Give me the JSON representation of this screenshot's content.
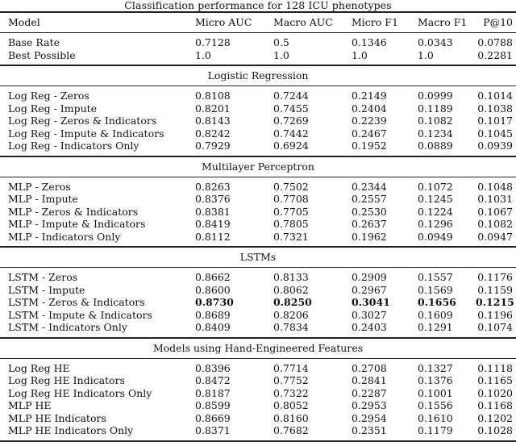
{
  "caption": "Classification performance for 128 ICU phenotypes",
  "columns": [
    "Model",
    "Micro AUC",
    "Macro AUC",
    "Micro F1",
    "Macro F1",
    "P@10"
  ],
  "baselines": [
    {
      "model": "Base Rate",
      "values": [
        "0.7128",
        "0.5",
        "0.1346",
        "0.0343",
        "0.0788"
      ]
    },
    {
      "model": "Best Possible",
      "values": [
        "1.0",
        "1.0",
        "1.0",
        "1.0",
        "0.2281"
      ]
    }
  ],
  "sections": [
    {
      "title": "Logistic Regression",
      "rows": [
        {
          "model": "Log Reg - Zeros",
          "values": [
            "0.8108",
            "0.7244",
            "0.2149",
            "0.0999",
            "0.1014"
          ]
        },
        {
          "model": "Log Reg - Impute",
          "values": [
            "0.8201",
            "0.7455",
            "0.2404",
            "0.1189",
            "0.1038"
          ]
        },
        {
          "model": "Log Reg - Zeros & Indicators",
          "values": [
            "0.8143",
            "0.7269",
            "0.2239",
            "0.1082",
            "0.1017"
          ]
        },
        {
          "model": "Log Reg - Impute & Indicators",
          "values": [
            "0.8242",
            "0.7442",
            "0.2467",
            "0.1234",
            "0.1045"
          ]
        },
        {
          "model": "Log Reg - Indicators Only",
          "values": [
            "0.7929",
            "0.6924",
            "0.1952",
            "0.0889",
            "0.0939"
          ]
        }
      ]
    },
    {
      "title": "Multilayer Perceptron",
      "rows": [
        {
          "model": "MLP - Zeros",
          "values": [
            "0.8263",
            "0.7502",
            "0.2344",
            "0.1072",
            "0.1048"
          ]
        },
        {
          "model": "MLP - Impute",
          "values": [
            "0.8376",
            "0.7708",
            "0.2557",
            "0.1245",
            "0.1031"
          ]
        },
        {
          "model": "MLP - Zeros & Indicators",
          "values": [
            "0.8381",
            "0.7705",
            "0.2530",
            "0.1224",
            "0.1067"
          ]
        },
        {
          "model": "MLP - Impute & Indicators",
          "values": [
            "0.8419",
            "0.7805",
            "0.2637",
            "0.1296",
            "0.1082"
          ]
        },
        {
          "model": "MLP - Indicators Only",
          "values": [
            "0.8112",
            "0.7321",
            "0.1962",
            "0.0949",
            "0.0947"
          ]
        }
      ]
    },
    {
      "title": "LSTMs",
      "rows": [
        {
          "model": "LSTM - Zeros",
          "values": [
            "0.8662",
            "0.8133",
            "0.2909",
            "0.1557",
            "0.1176"
          ]
        },
        {
          "model": "LSTM - Impute",
          "values": [
            "0.8600",
            "0.8062",
            "0.2967",
            "0.1569",
            "0.1159"
          ]
        },
        {
          "model": "LSTM - Zeros & Indicators",
          "values": [
            "0.8730",
            "0.8250",
            "0.3041",
            "0.1656",
            "0.1215"
          ],
          "bold": true
        },
        {
          "model": "LSTM - Impute & Indicators",
          "values": [
            "0.8689",
            "0.8206",
            "0.3027",
            "0.1609",
            "0.1196"
          ]
        },
        {
          "model": "LSTM - Indicators Only",
          "values": [
            "0.8409",
            "0.7834",
            "0.2403",
            "0.1291",
            "0.1074"
          ]
        }
      ]
    },
    {
      "title": "Models using Hand-Engineered Features",
      "rows": [
        {
          "model": "Log Reg HE",
          "values": [
            "0.8396",
            "0.7714",
            "0.2708",
            "0.1327",
            "0.1118"
          ]
        },
        {
          "model": "Log Reg HE Indicators",
          "values": [
            "0.8472",
            "0.7752",
            "0.2841",
            "0.1376",
            "0.1165"
          ]
        },
        {
          "model": "Log Reg HE Indicators Only",
          "values": [
            "0.8187",
            "0.7322",
            "0.2287",
            "0.1001",
            "0.1020"
          ]
        },
        {
          "model": "MLP HE",
          "values": [
            "0.8599",
            "0.8052",
            "0.2953",
            "0.1556",
            "0.1168"
          ]
        },
        {
          "model": "MLP HE Indicators",
          "values": [
            "0.8669",
            "0.8160",
            "0.2954",
            "0.1610",
            "0.1202"
          ]
        },
        {
          "model": "MLP HE Indicators Only",
          "values": [
            "0.8371",
            "0.7682",
            "0.2351",
            "0.1179",
            "0.1028"
          ]
        }
      ]
    }
  ]
}
